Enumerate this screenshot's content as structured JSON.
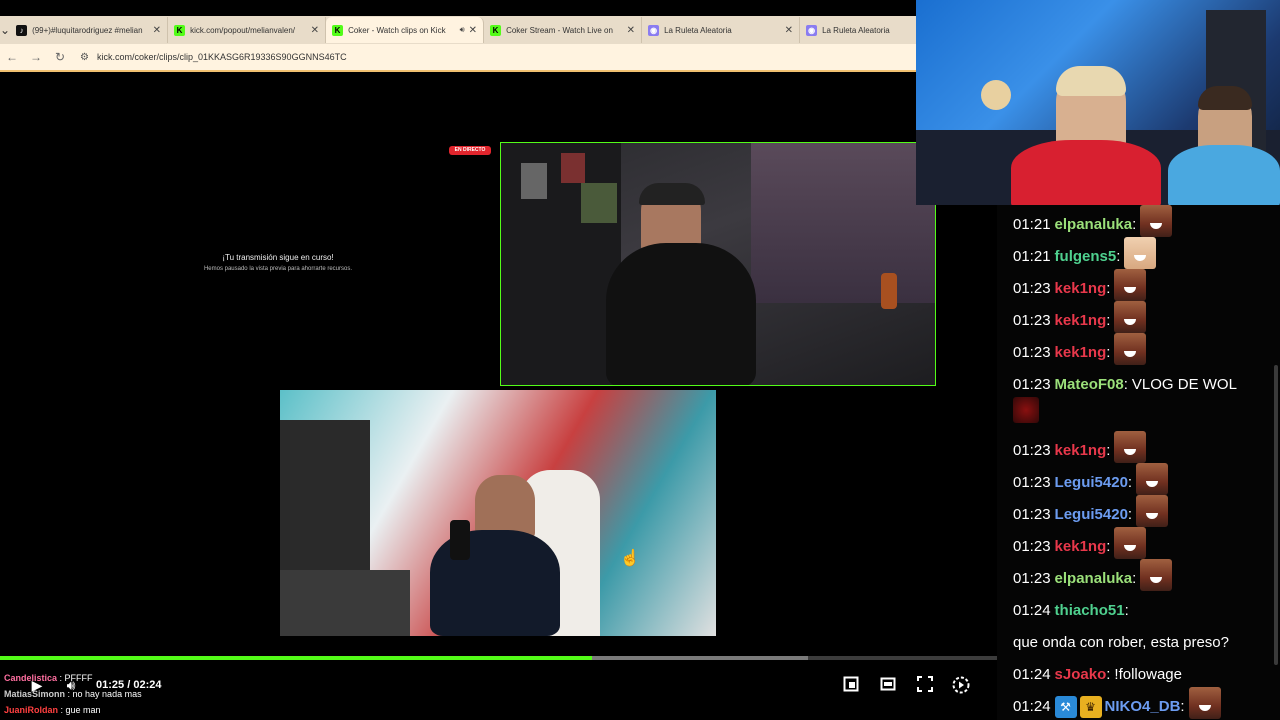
{
  "browser": {
    "tabs": [
      {
        "title": "(99+)#luquitarodriguez #melian",
        "favicon": "tiktok-icon",
        "color": "#111111"
      },
      {
        "title": "kick.com/popout/melianvalen/",
        "favicon": "kick-icon",
        "color": "#53fc18"
      },
      {
        "title": "Coker - Watch clips on Kick",
        "favicon": "kick-icon",
        "color": "#53fc18",
        "active": true
      },
      {
        "title": "Coker Stream - Watch Live on",
        "favicon": "kick-icon",
        "color": "#53fc18"
      },
      {
        "title": "La Ruleta Aleatoria",
        "favicon": "ruleta-icon",
        "color": "#8a7cf0"
      },
      {
        "title": "La Ruleta Aleatoria",
        "favicon": "ruleta-icon",
        "color": "#8a7cf0"
      }
    ],
    "url": "kick.com/coker/clips/clip_01KKASG6R19336S90GGNNS46TC"
  },
  "stream": {
    "live_badge": "EN DIRECTO",
    "paused_title": "¡Tu transmisión sigue en curso!",
    "paused_sub": "Hemos pausado la vista previa para ahorrarte recursos."
  },
  "chat": {
    "messages": [
      {
        "time": "01:21",
        "user": "elpanaluka",
        "color": "#9be07a",
        "emote": "face"
      },
      {
        "time": "01:21",
        "user": "fulgens5",
        "color": "#4fd18f",
        "emote": "face-alt"
      },
      {
        "time": "01:23",
        "user": "kek1ng",
        "color": "#e8384b",
        "emote": "face"
      },
      {
        "time": "01:23",
        "user": "kek1ng",
        "color": "#e8384b",
        "emote": "face"
      },
      {
        "time": "01:23",
        "user": "kek1ng",
        "color": "#e8384b",
        "emote": "face"
      },
      {
        "time": "01:23",
        "user": "MateoF08",
        "color": "#9be07a",
        "text": "VLOG DE WOL",
        "emote": "red"
      },
      {
        "time": "01:23",
        "user": "kek1ng",
        "color": "#e8384b",
        "emote": "face"
      },
      {
        "time": "01:23",
        "user": "Legui5420",
        "color": "#6c9cf0",
        "emote": "face"
      },
      {
        "time": "01:23",
        "user": "Legui5420",
        "color": "#6c9cf0",
        "emote": "face"
      },
      {
        "time": "01:23",
        "user": "kek1ng",
        "color": "#e8384b",
        "emote": "face"
      },
      {
        "time": "01:23",
        "user": "elpanaluka",
        "color": "#9be07a",
        "emote": "face"
      },
      {
        "time": "01:24",
        "user": "thiacho51",
        "color": "#4fd18f",
        "text": "que onda con rober, esta preso?"
      },
      {
        "time": "01:24",
        "user": "sJoako",
        "color": "#e8384b",
        "text": "!followage"
      },
      {
        "time": "01:24",
        "user": "NIKO4_DB",
        "color": "#6c9cf0",
        "emote": "face",
        "badges": true
      }
    ]
  },
  "player": {
    "current_time": "01:25",
    "separator": "/",
    "duration": "02:24",
    "progress_fraction": 0.594,
    "buffered_fraction": 0.81
  },
  "overlay_chat": [
    {
      "user": "Candelistica",
      "color": "#ff6fa0",
      "text": "PFFFF"
    },
    {
      "user": "MatiasSimonn",
      "color": "#cccccc",
      "text": "no hay nada mas"
    },
    {
      "user": "JuaniRoldan",
      "color": "#ff4040",
      "text": "gue man"
    }
  ]
}
